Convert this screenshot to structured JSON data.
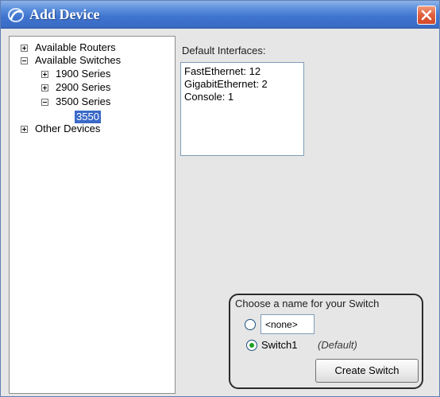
{
  "window": {
    "title": "Add Device",
    "icons": {
      "app": "app-swirl-icon",
      "close": "close-icon"
    },
    "colors": {
      "titlebar": "#3f74cf",
      "close": "#e0603b",
      "selection": "#3a69c7"
    }
  },
  "tree": {
    "items": [
      {
        "label": "Available Routers",
        "state": "collapsed"
      },
      {
        "label": "Available Switches",
        "state": "expanded"
      },
      {
        "label": "1900 Series",
        "state": "collapsed"
      },
      {
        "label": "2900 Series",
        "state": "collapsed"
      },
      {
        "label": "3500 Series",
        "state": "expanded"
      },
      {
        "label": "3550",
        "state": "selected"
      },
      {
        "label": "Other Devices",
        "state": "collapsed"
      }
    ]
  },
  "interfaces": {
    "label": "Default Interfaces:",
    "lines": [
      "FastEthernet: 12",
      "GigabitEthernet: 2",
      "Console: 1"
    ]
  },
  "naming": {
    "title": "Choose a name for your Switch",
    "custom_name_value": "<none>",
    "default_option": "Switch1",
    "default_tag": "(Default)",
    "selected_option": "Switch1",
    "create_button": "Create Switch"
  }
}
